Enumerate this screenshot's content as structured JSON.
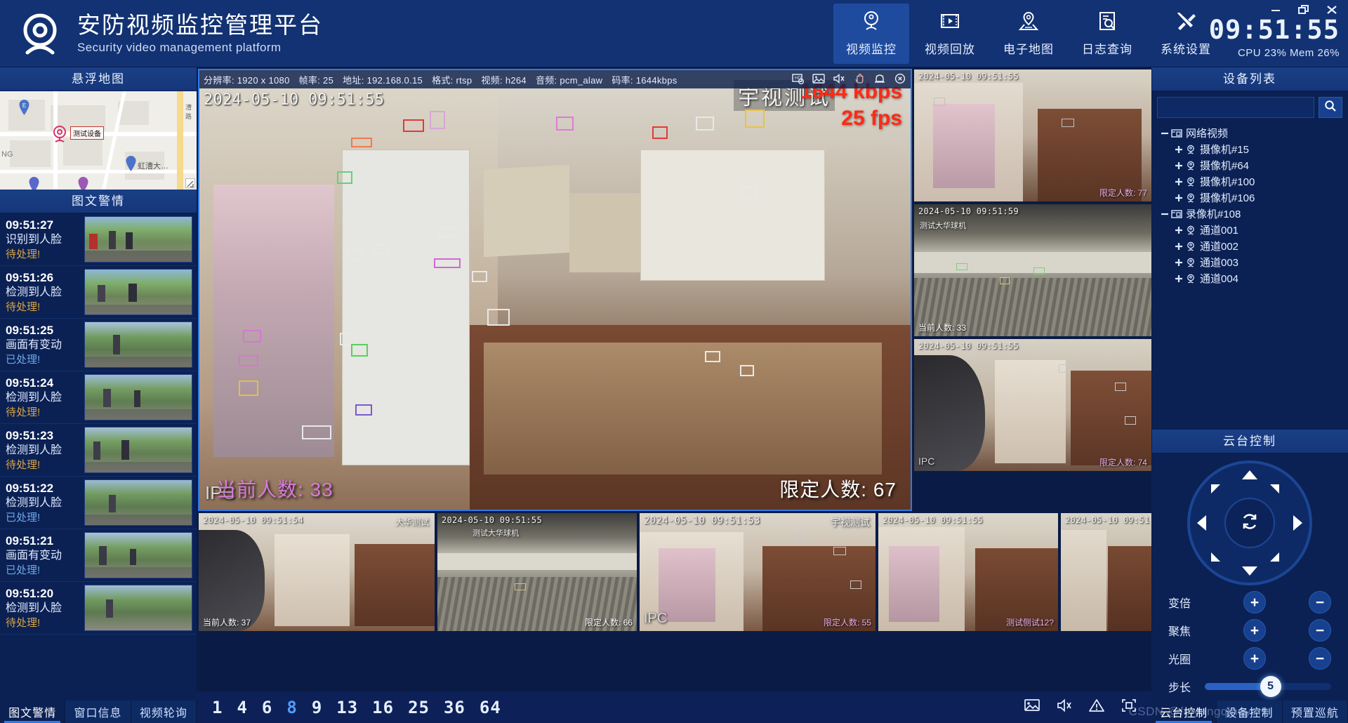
{
  "header": {
    "title_cn": "安防视频监控管理平台",
    "title_en": "Security video management platform",
    "logo_icon": "camera-dome-icon",
    "nav": [
      {
        "label": "视频监控",
        "icon": "camera-monitor-icon",
        "active": true
      },
      {
        "label": "视频回放",
        "icon": "film-playback-icon",
        "active": false
      },
      {
        "label": "电子地图",
        "icon": "map-pin-icon",
        "active": false
      },
      {
        "label": "日志查询",
        "icon": "log-search-icon",
        "active": false
      },
      {
        "label": "系统设置",
        "icon": "tools-settings-icon",
        "active": false
      }
    ],
    "window_buttons": [
      "minimize-icon",
      "restore-icon",
      "close-icon"
    ],
    "clock": "09:51:55",
    "sysinfo": "CPU 23%  Mem 26%",
    "cpu": "CPU 23%",
    "mem": "Mem 26%"
  },
  "left_panel": {
    "map_title": "悬浮地图",
    "map": {
      "device_label": "测试设备",
      "poi_labels": [
        "虹漕大...",
        "NG",
        "漕路"
      ],
      "markers": [
        "pin-e-icon",
        "camera-marker-icon",
        "pin-blue-icon",
        "pin-purple-icon"
      ]
    },
    "alarm_title": "图文警情",
    "alarms": [
      {
        "time": "09:51:27",
        "type": "识别到人脸",
        "status": "待处理!",
        "state": "pending"
      },
      {
        "time": "09:51:26",
        "type": "检测到人脸",
        "status": "待处理!",
        "state": "pending"
      },
      {
        "time": "09:51:25",
        "type": "画面有变动",
        "status": "已处理!",
        "state": "done"
      },
      {
        "time": "09:51:24",
        "type": "检测到人脸",
        "status": "待处理!",
        "state": "pending"
      },
      {
        "time": "09:51:23",
        "type": "检测到人脸",
        "status": "待处理!",
        "state": "pending"
      },
      {
        "time": "09:51:22",
        "type": "检测到人脸",
        "status": "已处理!",
        "state": "done"
      },
      {
        "time": "09:51:21",
        "type": "画面有变动",
        "status": "已处理!",
        "state": "done"
      },
      {
        "time": "09:51:20",
        "type": "检测到人脸",
        "status": "待处理!",
        "state": "pending"
      }
    ],
    "tabs": [
      {
        "label": "图文警情",
        "active": true
      },
      {
        "label": "窗口信息",
        "active": false
      },
      {
        "label": "视频轮询",
        "active": false
      }
    ]
  },
  "video": {
    "info_bar": {
      "resolution_label": "分辨率:",
      "resolution": "1920 x 1080",
      "fps_label": "帧率:",
      "fps": "25",
      "addr_label": "地址:",
      "addr": "192.168.0.15",
      "format_label": "格式:",
      "format": "rtsp",
      "video_label": "视频:",
      "video_codec": "h264",
      "audio_label": "音频:",
      "audio_codec": "pcm_alaw",
      "bitrate_label": "码率:",
      "bitrate": "1644kbps"
    },
    "info_icons": [
      "record-video-icon",
      "snapshot-icon",
      "mute-icon",
      "ptz-hand-icon",
      "alarm-bell-icon",
      "close-icon"
    ],
    "main_overlay": {
      "watermark": "宇视测试",
      "bitrate_red": "1644 kbps",
      "fps_red": "25 fps",
      "timestamp": "2024-05-10 09:51:55",
      "current_count": "当前人数: 33",
      "limit_count": "限定人数: 67",
      "ipc_tag": "IPC"
    },
    "cells": [
      {
        "id": "cell-r1c1",
        "timestamp": "2024-05-10 09:51:55",
        "watermark": "",
        "limit": "限定人数: 77"
      },
      {
        "id": "cell-r1c2",
        "timestamp": "2024-05-10 09:51:55",
        "watermark": "",
        "limit": ""
      },
      {
        "id": "cell-r2c1",
        "timestamp": "2024-05-10 09:51:59",
        "watermark": "测试大华球机",
        "limit": "当前人数: 33"
      },
      {
        "id": "cell-r3c1",
        "timestamp": "2024-05-10 09:51:55",
        "watermark": "",
        "limit": "限定人数: 74"
      },
      {
        "id": "cell-b1",
        "timestamp": "2024-05-10 09:51:54",
        "watermark": "大华测试",
        "limit": "当前人数: 37"
      },
      {
        "id": "cell-b2",
        "timestamp": "2024-05-10 09:51:55",
        "watermark": "测试大华球机",
        "limit": "限定人数: 66"
      },
      {
        "id": "cell-b3",
        "timestamp": "2024-05-10 09:51:53",
        "watermark": "宇视测试",
        "limit": "限定人数: 55",
        "ipc": "IPC"
      },
      {
        "id": "cell-b4",
        "timestamp": "2024-05-10 09:51:55",
        "watermark": "",
        "limit": "测试侧试12?"
      },
      {
        "id": "cell-b5",
        "timestamp": "2024-05-10 09:51",
        "watermark": "",
        "limit": ""
      }
    ],
    "bottom_bar": {
      "layouts": [
        {
          "value": "1",
          "active": false
        },
        {
          "value": "4",
          "active": false
        },
        {
          "value": "6",
          "active": false
        },
        {
          "value": "8",
          "active": true
        },
        {
          "value": "9",
          "active": false
        },
        {
          "value": "13",
          "active": false
        },
        {
          "value": "16",
          "active": false
        },
        {
          "value": "25",
          "active": false
        },
        {
          "value": "36",
          "active": false
        },
        {
          "value": "64",
          "active": false
        }
      ],
      "icons": [
        "snapshot-icon",
        "mute-icon",
        "warning-icon",
        "fullscreen-icon"
      ]
    }
  },
  "right_panel": {
    "device_title": "设备列表",
    "search_placeholder": "",
    "search_value": "",
    "search_icon": "search-icon",
    "tree": [
      {
        "label": "网络视频",
        "level": 0,
        "expander": "minus",
        "icon": "nvr-icon"
      },
      {
        "label": "摄像机#15",
        "level": 1,
        "expander": "plus",
        "icon": "camera-icon"
      },
      {
        "label": "摄像机#64",
        "level": 1,
        "expander": "plus",
        "icon": "camera-icon"
      },
      {
        "label": "摄像机#100",
        "level": 1,
        "expander": "plus",
        "icon": "camera-icon"
      },
      {
        "label": "摄像机#106",
        "level": 1,
        "expander": "plus",
        "icon": "camera-icon"
      },
      {
        "label": "录像机#108",
        "level": 0,
        "expander": "minus",
        "icon": "nvr-icon"
      },
      {
        "label": "通道001",
        "level": 1,
        "expander": "plus",
        "icon": "camera-icon"
      },
      {
        "label": "通道002",
        "level": 1,
        "expander": "plus",
        "icon": "camera-icon"
      },
      {
        "label": "通道003",
        "level": 1,
        "expander": "plus",
        "icon": "camera-icon"
      },
      {
        "label": "通道004",
        "level": 1,
        "expander": "plus",
        "icon": "camera-icon"
      }
    ],
    "ptz_title": "云台控制",
    "ptz_rows": [
      {
        "label": "变倍",
        "plus": "+",
        "minus": "−"
      },
      {
        "label": "聚焦",
        "plus": "+",
        "minus": "−"
      },
      {
        "label": "光圈",
        "plus": "+",
        "minus": "−"
      }
    ],
    "step_label": "步长",
    "step_value": "5",
    "step_percent": 52,
    "tabs": [
      {
        "label": "云台控制",
        "active": true
      },
      {
        "label": "设备控制",
        "active": false
      },
      {
        "label": "预置巡航",
        "active": false
      }
    ]
  },
  "watermark": "CSDN @feiyangqingyun",
  "colors": {
    "header_bg": "#123273",
    "panel_bg": "#0b2154",
    "accent": "#2f7ae5",
    "pending": "#d9a441",
    "done": "#6fa8e8",
    "alert_red": "#ff2a14"
  }
}
